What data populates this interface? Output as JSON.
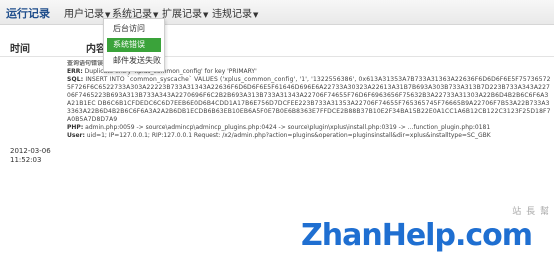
{
  "app": {
    "brand": "运行记录"
  },
  "nav": [
    {
      "label": "用户记录"
    },
    {
      "label": "系统记录"
    },
    {
      "label": "扩展记录"
    },
    {
      "label": "违规记录"
    }
  ],
  "dropdown": {
    "items": [
      "后台访问",
      "系统错误",
      "邮件发送失败"
    ],
    "active_index": 1
  },
  "table": {
    "headers": [
      "时间",
      "内容"
    ]
  },
  "log": {
    "date": "2012-03-06",
    "time": "11:52:03",
    "category": "查询语句错误",
    "err_label": "ERR:",
    "err_text": "Duplicate entry 'xplus_common_config' for key 'PRIMARY'",
    "sql_label": "SQL:",
    "sql_text": "INSERT INTO `common_syscache` VALUES ('xplus_common_config', '1', '1322556386', 0x613A31353A7B733A31363A22636F6D6D6F6E5F757365725F726F6C6522733A303A22223B733A31343A22636F6D6D6F6E5F61646D696E6A22733A30323A22613A31B7B693A303B733A313B7D223B733A343A22706F7465223B693A313B733A343A2270696F6C2B2B693A313B733A31343A22706F74655F76D6F6963656F75632B3A22733A31303A22B6D4B2B6C6F6A3A21B1EC DB6C6B1CFDEDC6C6D7EEB6E0D6B4CDD1A17B6E756D7DCFEE223B733A31353A22706F74655F765365745F76665B9A22706F7B53A22B733A33363A22B6D4B2B6C6F6A3A2A2B6DB1ECDB6B63EB10EB6A5F0E7B0E6B8363E7FFDCE2B88B37B10E2F34BA15B22E0A1CC1A6B12CB122C3123F25D18F7A0B5A7D8D7A9",
    "php_label": "PHP:",
    "php_text": "admin.php:0059 -> source\\admincp\\admincp_plugins.php:0424 -> source\\plugin\\xplus\\install.php:0319 -> ...function_plugin.php:0181",
    "user_label": "User:",
    "user_text": "uid=1; IP=127.0.0.1; RIP:127.0.0.1 Request: /x2/admin.php?action=plugins&operation=pluginsinstall&dir=xplus&installtype=SC_GBK"
  },
  "watermark": {
    "text": "ZhanHelp.com",
    "sub": "站 長 幫"
  }
}
